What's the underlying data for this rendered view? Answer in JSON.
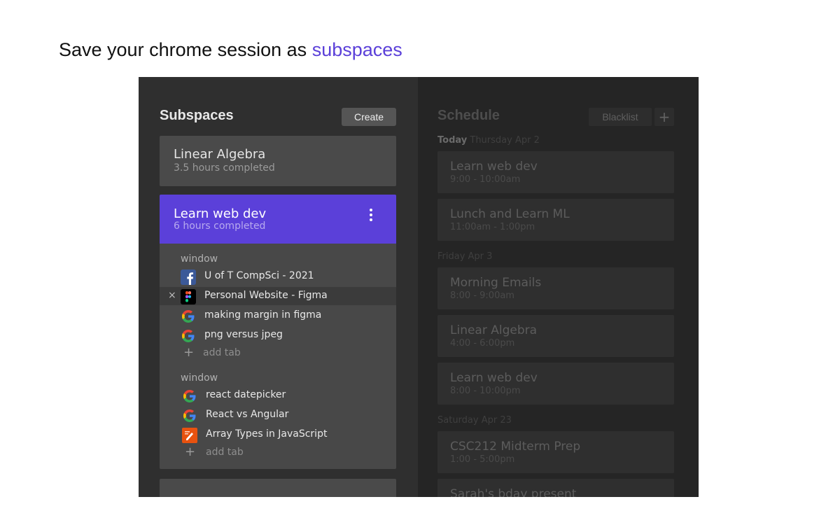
{
  "headline": {
    "prefix": "Save your chrome session as",
    "accent": "subspaces",
    "accent_color": "#5b40d9"
  },
  "subspaces": {
    "title": "Subspaces",
    "create_label": "Create",
    "cards": [
      {
        "name": "Linear Algebra",
        "progress": "3.5 hours completed"
      },
      {
        "name": "Learn web dev",
        "progress": "6 hours completed",
        "color": "#5b40d9",
        "menu_icon": "kebab-menu-icon",
        "windows": [
          {
            "label": "window",
            "tabs": [
              {
                "title": "U of T CompSci - 2021",
                "icon": "facebook-icon"
              },
              {
                "title": "Personal Website - Figma",
                "icon": "figma-icon",
                "selected": true,
                "close": "×"
              },
              {
                "title": "making margin in figma",
                "icon": "google-icon"
              },
              {
                "title": "png versus jpeg",
                "icon": "google-icon"
              }
            ],
            "add_tab_label": "add tab"
          },
          {
            "label": "window",
            "tabs": [
              {
                "title": "react datepicker",
                "icon": "google-icon"
              },
              {
                "title": "React vs Angular",
                "icon": "google-icon"
              },
              {
                "title": "Array Types in JavaScript",
                "icon": "javascript-doc-icon"
              }
            ],
            "add_tab_label": "add tab"
          }
        ]
      }
    ]
  },
  "schedule": {
    "title": "Schedule",
    "blacklist_label": "Blacklist",
    "add_symbol": "+",
    "days": [
      {
        "label_strong": "Today",
        "label": "Thursday Apr 2",
        "events": [
          {
            "name": "Learn web dev",
            "time": "9:00 - 10:00am"
          },
          {
            "name": "Lunch and Learn ML",
            "time": "11:00am - 1:00pm"
          }
        ]
      },
      {
        "label_strong": "",
        "label": "Friday Apr 3",
        "events": [
          {
            "name": "Morning Emails",
            "time": "8:00 - 9:00am"
          },
          {
            "name": "Linear Algebra",
            "time": "4:00 - 6:00pm"
          },
          {
            "name": "Learn web dev",
            "time": "8:00 - 10:00pm"
          }
        ]
      },
      {
        "label_strong": "",
        "label": "Saturday Apr 23",
        "events": [
          {
            "name": "CSC212 Midterm Prep",
            "time": "1:00 - 5:00pm"
          },
          {
            "name": "Sarah's bday present",
            "time": ""
          }
        ]
      }
    ]
  }
}
